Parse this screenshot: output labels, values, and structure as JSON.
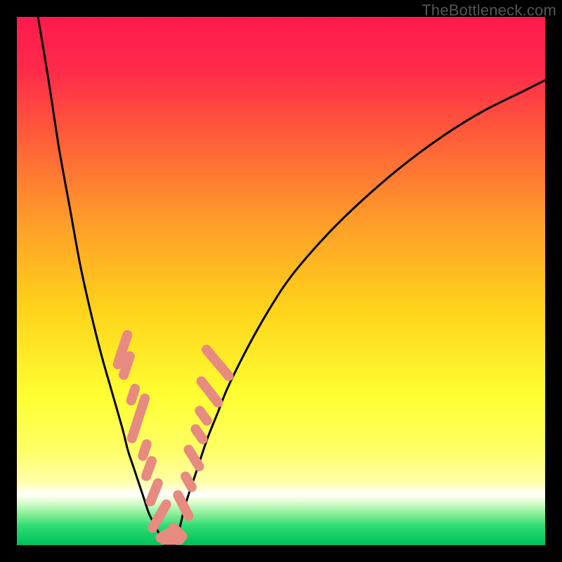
{
  "watermark": "TheBottleneck.com",
  "chart_data": {
    "type": "line",
    "title": "",
    "xlabel": "",
    "ylabel": "",
    "xlim": [
      0,
      100
    ],
    "ylim": [
      0,
      100
    ],
    "grid": false,
    "axes_visible": false,
    "background": {
      "type": "vertical-gradient",
      "stops": [
        {
          "pos": 0.0,
          "color": "#ff1a4d"
        },
        {
          "pos": 0.1,
          "color": "#ff2a4a"
        },
        {
          "pos": 0.22,
          "color": "#ff5a3a"
        },
        {
          "pos": 0.38,
          "color": "#ff9a2a"
        },
        {
          "pos": 0.55,
          "color": "#ffd21a"
        },
        {
          "pos": 0.72,
          "color": "#ffff33"
        },
        {
          "pos": 0.82,
          "color": "#ffff66"
        },
        {
          "pos": 0.88,
          "color": "#ffffaa"
        },
        {
          "pos": 0.905,
          "color": "#ffffff"
        },
        {
          "pos": 0.915,
          "color": "#e8ffd6"
        },
        {
          "pos": 0.94,
          "color": "#8cf09a"
        },
        {
          "pos": 0.965,
          "color": "#2bdc72"
        },
        {
          "pos": 1.0,
          "color": "#00c05a"
        }
      ]
    },
    "series": [
      {
        "name": "left-descending",
        "x": [
          4,
          6,
          8,
          10,
          12,
          14,
          16,
          18,
          20,
          21,
          22,
          23,
          24,
          25,
          26,
          27,
          28
        ],
        "y": [
          100,
          88,
          75,
          64,
          53,
          44,
          36,
          29,
          22,
          18,
          15,
          12,
          9,
          6,
          4,
          2,
          0
        ]
      },
      {
        "name": "right-ascending",
        "x": [
          30,
          31,
          32,
          34,
          36,
          38,
          40,
          44,
          48,
          52,
          58,
          64,
          72,
          80,
          88,
          96,
          100
        ],
        "y": [
          0,
          4,
          8,
          14,
          20,
          25,
          30,
          38,
          45,
          51,
          58,
          64,
          71,
          77,
          82,
          86,
          88
        ]
      }
    ],
    "valley_floor_x": [
      28,
      30
    ],
    "annotations": {
      "name": "salmon-blobs",
      "color": "#e78a80",
      "items": [
        {
          "x": 20.0,
          "y": 37.0,
          "len": 5.5,
          "angle": -72
        },
        {
          "x": 20.8,
          "y": 34.0,
          "len": 4.0,
          "angle": -72
        },
        {
          "x": 22.0,
          "y": 28.5,
          "len": 3.0,
          "angle": -72
        },
        {
          "x": 23.0,
          "y": 24.0,
          "len": 7.0,
          "angle": -72
        },
        {
          "x": 24.2,
          "y": 18.0,
          "len": 3.0,
          "angle": -72
        },
        {
          "x": 25.0,
          "y": 14.5,
          "len": 3.5,
          "angle": -70
        },
        {
          "x": 26.0,
          "y": 10.0,
          "len": 4.0,
          "angle": -68
        },
        {
          "x": 27.0,
          "y": 5.5,
          "len": 5.0,
          "angle": -60
        },
        {
          "x": 28.2,
          "y": 2.0,
          "len": 3.0,
          "angle": -30
        },
        {
          "x": 29.3,
          "y": 1.0,
          "len": 3.5,
          "angle": 0
        },
        {
          "x": 30.5,
          "y": 2.5,
          "len": 3.0,
          "angle": 45
        },
        {
          "x": 31.5,
          "y": 7.5,
          "len": 4.5,
          "angle": 63
        },
        {
          "x": 32.5,
          "y": 12.0,
          "len": 3.0,
          "angle": 60
        },
        {
          "x": 33.5,
          "y": 16.5,
          "len": 4.0,
          "angle": 58
        },
        {
          "x": 34.5,
          "y": 21.0,
          "len": 3.0,
          "angle": 55
        },
        {
          "x": 35.3,
          "y": 24.5,
          "len": 3.0,
          "angle": 54
        },
        {
          "x": 36.5,
          "y": 29.0,
          "len": 5.0,
          "angle": 52
        },
        {
          "x": 38.0,
          "y": 34.5,
          "len": 6.0,
          "angle": 50
        }
      ]
    }
  }
}
